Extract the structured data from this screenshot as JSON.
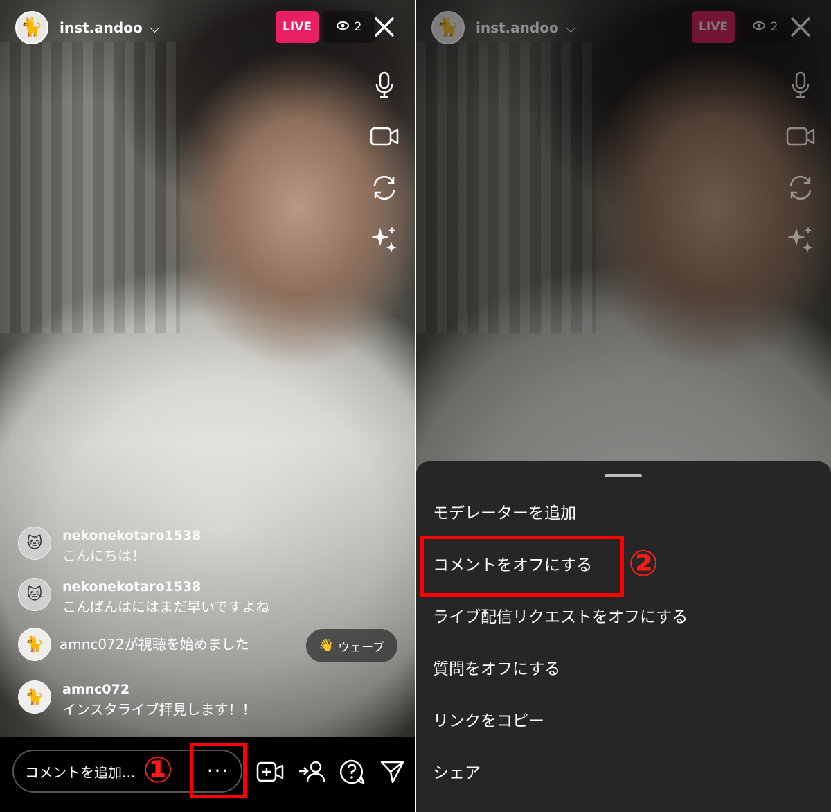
{
  "left": {
    "header": {
      "username": "inst.andoo",
      "live_label": "LIVE",
      "viewer_count": "2"
    },
    "comments": [
      {
        "user": "nekonekotaro1538",
        "text": "こんにちは！"
      },
      {
        "user": "nekonekotaro1538",
        "text": "こんばんはにはまだ早いですよね"
      }
    ],
    "join_message": "amnc072が視聴を始めました",
    "wave_label": "ウェーブ",
    "last_comment": {
      "user": "amnc072",
      "text": "インスタライブ拝見します！！"
    },
    "bottom": {
      "comment_placeholder": "コメントを追加...",
      "more_label": "···"
    },
    "step_marker": "①"
  },
  "right": {
    "header": {
      "username": "inst.andoo",
      "live_label": "LIVE",
      "viewer_count": "2"
    },
    "menu": [
      "モデレーターを追加",
      "コメントをオフにする",
      "ライブ配信リクエストをオフにする",
      "質問をオフにする",
      "リンクをコピー",
      "シェア"
    ],
    "step_marker": "②"
  },
  "icons": {
    "eye": "eye-icon",
    "close": "close-icon",
    "mic": "microphone-icon",
    "video": "video-camera-icon",
    "flip": "flip-camera-icon",
    "effects": "sparkles-icon",
    "add_guest": "add-video-icon",
    "invite": "invite-person-icon",
    "question": "question-icon",
    "send": "send-icon",
    "wave": "wave-hand-icon"
  },
  "colors": {
    "live_badge": "#e91e63",
    "annotation_red": "#ff0000",
    "sheet_bg": "#262626"
  }
}
